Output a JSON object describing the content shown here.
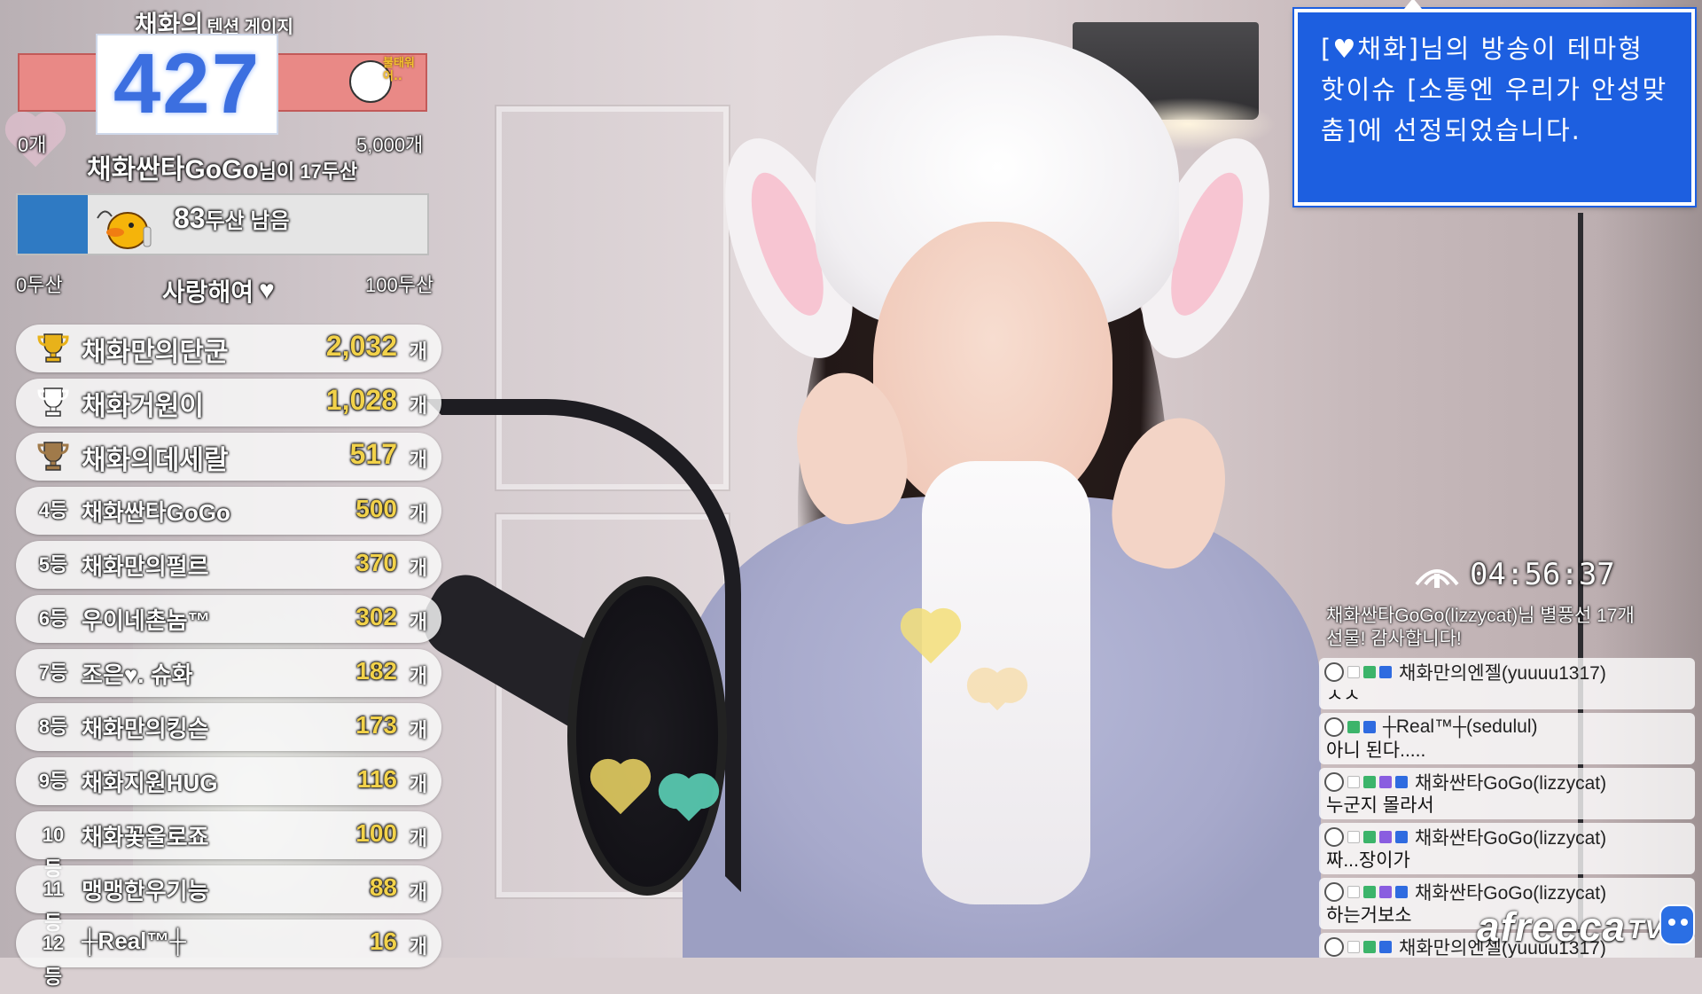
{
  "gauge": {
    "title": "채화의",
    "subtitle": "텐션 게이지",
    "count": "427",
    "mascot_text": "불태워어..",
    "min_label": "0개",
    "max_label": "5,000개",
    "fill_fraction": 0.085
  },
  "donor": {
    "name": "채화싼타GoGo",
    "suffix": "님이 17두산"
  },
  "goal": {
    "text": "83",
    "text_suffix": "두산 남음",
    "min_label": "0두산",
    "max_label": "100두산",
    "progress_fraction": 0.17,
    "love_text": "사랑해여",
    "love_heart": "♥"
  },
  "ranking": {
    "unit": "개",
    "items": [
      {
        "pos": "",
        "icon": "gold-trophy-icon",
        "name": "채화만의단군",
        "count": "2,032"
      },
      {
        "pos": "",
        "icon": "silver-trophy-icon",
        "name": "채화거원이",
        "count": "1,028"
      },
      {
        "pos": "",
        "icon": "bronze-trophy-icon",
        "name": "채화의데세랄",
        "count": "517"
      },
      {
        "pos": "4등",
        "icon": "",
        "name": "채화싼타GoGo",
        "count": "500"
      },
      {
        "pos": "5등",
        "icon": "",
        "name": "채화만의펄르",
        "count": "370"
      },
      {
        "pos": "6등",
        "icon": "",
        "name": "우이네촌놈™",
        "count": "302"
      },
      {
        "pos": "7등",
        "icon": "",
        "name": "조은♥. 슈화",
        "count": "182"
      },
      {
        "pos": "8등",
        "icon": "",
        "name": "채화만의킹슨",
        "count": "173"
      },
      {
        "pos": "9등",
        "icon": "",
        "name": "채화지원HUG",
        "count": "116"
      },
      {
        "pos": "10등",
        "icon": "",
        "name": "채화꽃울로죠",
        "count": "100"
      },
      {
        "pos": "11등",
        "icon": "",
        "name": "맹맹한우기능",
        "count": "88"
      },
      {
        "pos": "12등",
        "icon": "",
        "name": "┼Real™┼",
        "count": "16"
      }
    ]
  },
  "notice": {
    "text": "[♥채화]님의 방송이 테마형 핫이슈 [소통엔 우리가 안성맞춤]에 선정되었습니다."
  },
  "timer": {
    "value": "04:56:37"
  },
  "chat": {
    "messages": [
      {
        "nick": "",
        "body": "채화싼타GoGo(lizzycat)님 별풍선 17개",
        "body2": "선물! 감사합니다!",
        "system": true
      },
      {
        "nick": "채화만의엔젤(yuuuu1317)",
        "body": "ㅅㅅ"
      },
      {
        "nick": "┼Real™┼(sedulul)",
        "body": "아니 된다....."
      },
      {
        "nick": "채화싼타GoGo(lizzycat)",
        "body": "누군지 몰라서"
      },
      {
        "nick": "채화싼타GoGo(lizzycat)",
        "body": "짜...장이가"
      },
      {
        "nick": "채화싼타GoGo(lizzycat)",
        "body": "하는거보소"
      },
      {
        "nick": "채화만의엔젤(yuuuu1317)",
        "body": ""
      }
    ]
  },
  "logo": {
    "text": "afreeca",
    "tv": "TV"
  },
  "colors": {
    "gauge_bar": "#e98986",
    "count_blue": "#3c6fe0",
    "goal_fill": "#2f7ac3",
    "rank_count_gold": "#f2d24a",
    "notice_bg": "#1d5fe0"
  }
}
